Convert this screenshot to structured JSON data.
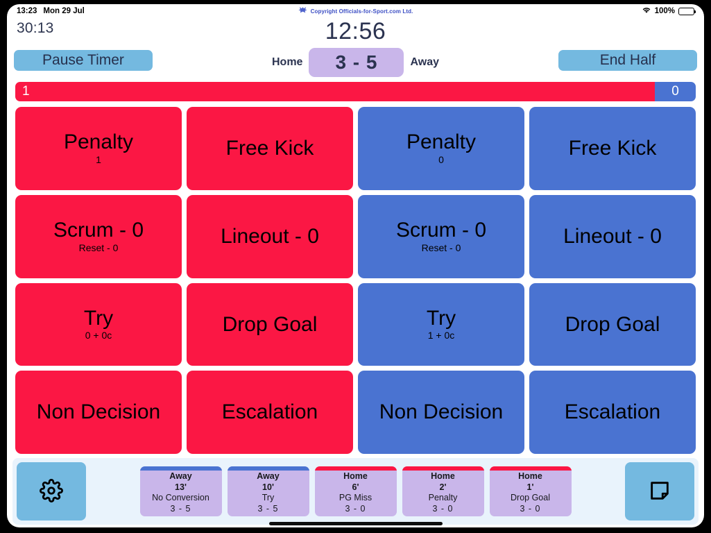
{
  "statusbar": {
    "time": "13:23",
    "date": "Mon 29 Jul",
    "copyright": "Copyright Officials-for-Sport.com Ltd.",
    "battery_percent": "100%"
  },
  "header": {
    "elapsed_time": "30:13",
    "match_clock": "12:56",
    "pause_button": "Pause Timer",
    "end_half_button": "End Half",
    "home_label": "Home",
    "away_label": "Away",
    "score": "3 - 5"
  },
  "possession": {
    "home_count": "1",
    "away_count": "0",
    "home_color": "#fb1744",
    "away_color": "#4a73d1",
    "home_percent": 94
  },
  "actions": [
    {
      "title": "Penalty",
      "sub": "1",
      "team": "home"
    },
    {
      "title": "Free Kick",
      "sub": "",
      "team": "home"
    },
    {
      "title": "Penalty",
      "sub": "0",
      "team": "away"
    },
    {
      "title": "Free Kick",
      "sub": "",
      "team": "away"
    },
    {
      "title": "Scrum - 0",
      "sub": "Reset - 0",
      "team": "home"
    },
    {
      "title": "Lineout - 0",
      "sub": "",
      "team": "home"
    },
    {
      "title": "Scrum - 0",
      "sub": "Reset - 0",
      "team": "away"
    },
    {
      "title": "Lineout - 0",
      "sub": "",
      "team": "away"
    },
    {
      "title": "Try",
      "sub": "0 + 0c",
      "team": "home"
    },
    {
      "title": "Drop Goal",
      "sub": "",
      "team": "home"
    },
    {
      "title": "Try",
      "sub": "1 + 0c",
      "team": "away"
    },
    {
      "title": "Drop Goal",
      "sub": "",
      "team": "away"
    },
    {
      "title": "Non Decision",
      "sub": "",
      "team": "home"
    },
    {
      "title": "Escalation",
      "sub": "",
      "team": "home"
    },
    {
      "title": "Non Decision",
      "sub": "",
      "team": "away"
    },
    {
      "title": "Escalation",
      "sub": "",
      "team": "away"
    }
  ],
  "bottombar": {
    "settings_icon": "gear-icon",
    "notes_icon": "note-icon",
    "events": [
      {
        "team": "Away",
        "time": "13'",
        "type": "No Conversion",
        "score": "3 - 5",
        "side": "away"
      },
      {
        "team": "Away",
        "time": "10'",
        "type": "Try",
        "score": "3 - 5",
        "side": "away"
      },
      {
        "team": "Home",
        "time": "6'",
        "type": "PG Miss",
        "score": "3 - 0",
        "side": "home"
      },
      {
        "team": "Home",
        "time": "2'",
        "type": "Penalty",
        "score": "3 - 0",
        "side": "home"
      },
      {
        "team": "Home",
        "time": "1'",
        "type": "Drop Goal",
        "score": "3 - 0",
        "side": "home"
      }
    ]
  }
}
